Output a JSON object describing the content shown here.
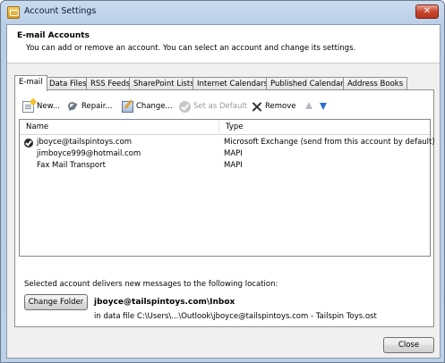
{
  "window": {
    "title": "Account Settings",
    "close_glyph": "✕"
  },
  "header": {
    "title": "E-mail Accounts",
    "subtitle": "You can add or remove an account. You can select an account and change its settings."
  },
  "tabs": [
    {
      "label": "E-mail",
      "active": true
    },
    {
      "label": "Data Files"
    },
    {
      "label": "RSS Feeds"
    },
    {
      "label": "SharePoint Lists"
    },
    {
      "label": "Internet Calendars"
    },
    {
      "label": "Published Calendars"
    },
    {
      "label": "Address Books"
    }
  ],
  "toolbar": {
    "new": "New...",
    "repair": "Repair...",
    "change": "Change...",
    "set_default": "Set as Default",
    "remove": "Remove"
  },
  "list": {
    "columns": {
      "name": "Name",
      "type": "Type"
    },
    "rows": [
      {
        "name": "jboyce@tailspintoys.com",
        "type": "Microsoft Exchange (send from this account by default)",
        "is_default": true
      },
      {
        "name": "jimboyce999@hotmail.com",
        "type": "MAPI"
      },
      {
        "name": "Fax Mail Transport",
        "type": "MAPI"
      }
    ]
  },
  "delivery": {
    "label": "Selected account delivers new messages to the following location:",
    "change_folder": "Change Folder",
    "folder": "jboyce@tailspintoys.com\\Inbox",
    "data_file": "in data file C:\\Users\\...\\Outlook\\jboyce@tailspintoys.com - Tailspin Toys.ost"
  },
  "footer": {
    "close": "Close"
  },
  "colors": {
    "title_bar": "#c9dbef",
    "close_button": "#c7452d",
    "down_arrow": "#2b6fd0"
  }
}
